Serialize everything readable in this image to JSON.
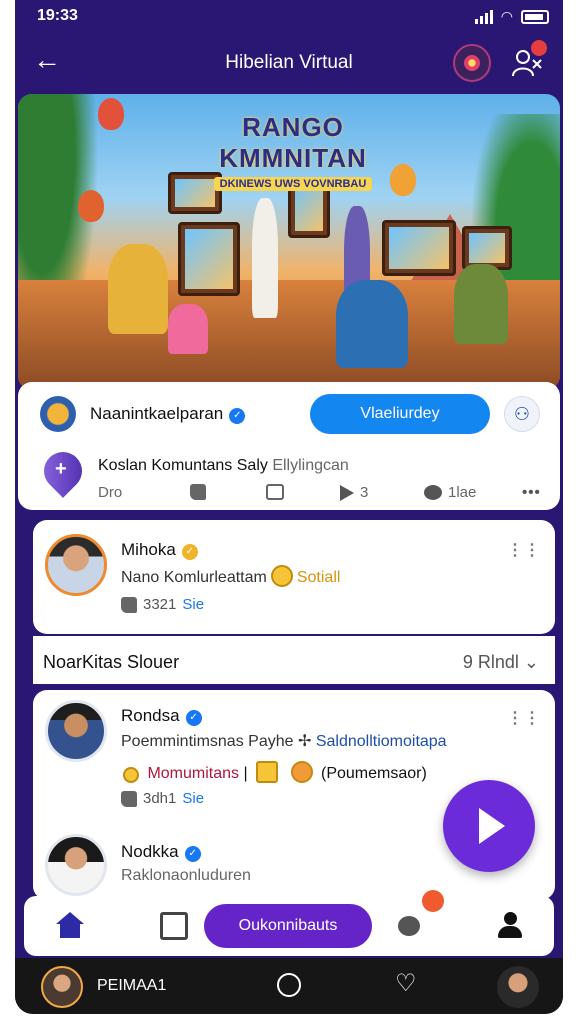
{
  "status_bar": {
    "time": "19:33"
  },
  "app_bar": {
    "title": "Hibelian Virtual",
    "back_icon": "back-arrow-icon",
    "notification_badge": ""
  },
  "hero": {
    "banner_title": "RANGO KMMNITAN",
    "banner_subtitle": "DKINEWS UWS VOVNRBAU"
  },
  "post": {
    "page_name": "Naanintkaelparan",
    "follow_label": "Vlaeliurdey",
    "title": "Koslan Komuntans Saly",
    "title_extra": "Ellylingcan",
    "actions": {
      "reactions_label": "Dro",
      "share_count": "3",
      "comment_label": "1lae"
    }
  },
  "comment": {
    "name": "Mihoka",
    "text": "Nano Komlurleattam",
    "highlight": "Sotiall",
    "likes": "3321",
    "reply_label": "Sie"
  },
  "section": {
    "title": "NoarKitas Slouer",
    "filter_count": "9",
    "filter_label": "Rlndl"
  },
  "feed": [
    {
      "name": "Rondsa",
      "line1": "Poemmintimsnas Payhe",
      "line1_link": "Saldnolltiomoitapa",
      "line2_red": "Momumitans",
      "line2_end": "(Poumemsaor)",
      "likes": "3dh1",
      "reply_label": "Sie"
    },
    {
      "name": "Nodkka",
      "sub": "Raklonaonluduren"
    }
  ],
  "tab_bar": {
    "center_label": "Oukonnibauts"
  },
  "system_bar": {
    "label": "PEIMAA1"
  },
  "colors": {
    "app_background": "#2a1773",
    "accent_blue": "#1486ef",
    "accent_purple": "#6524c8",
    "verified_blue": "#1877f2"
  }
}
